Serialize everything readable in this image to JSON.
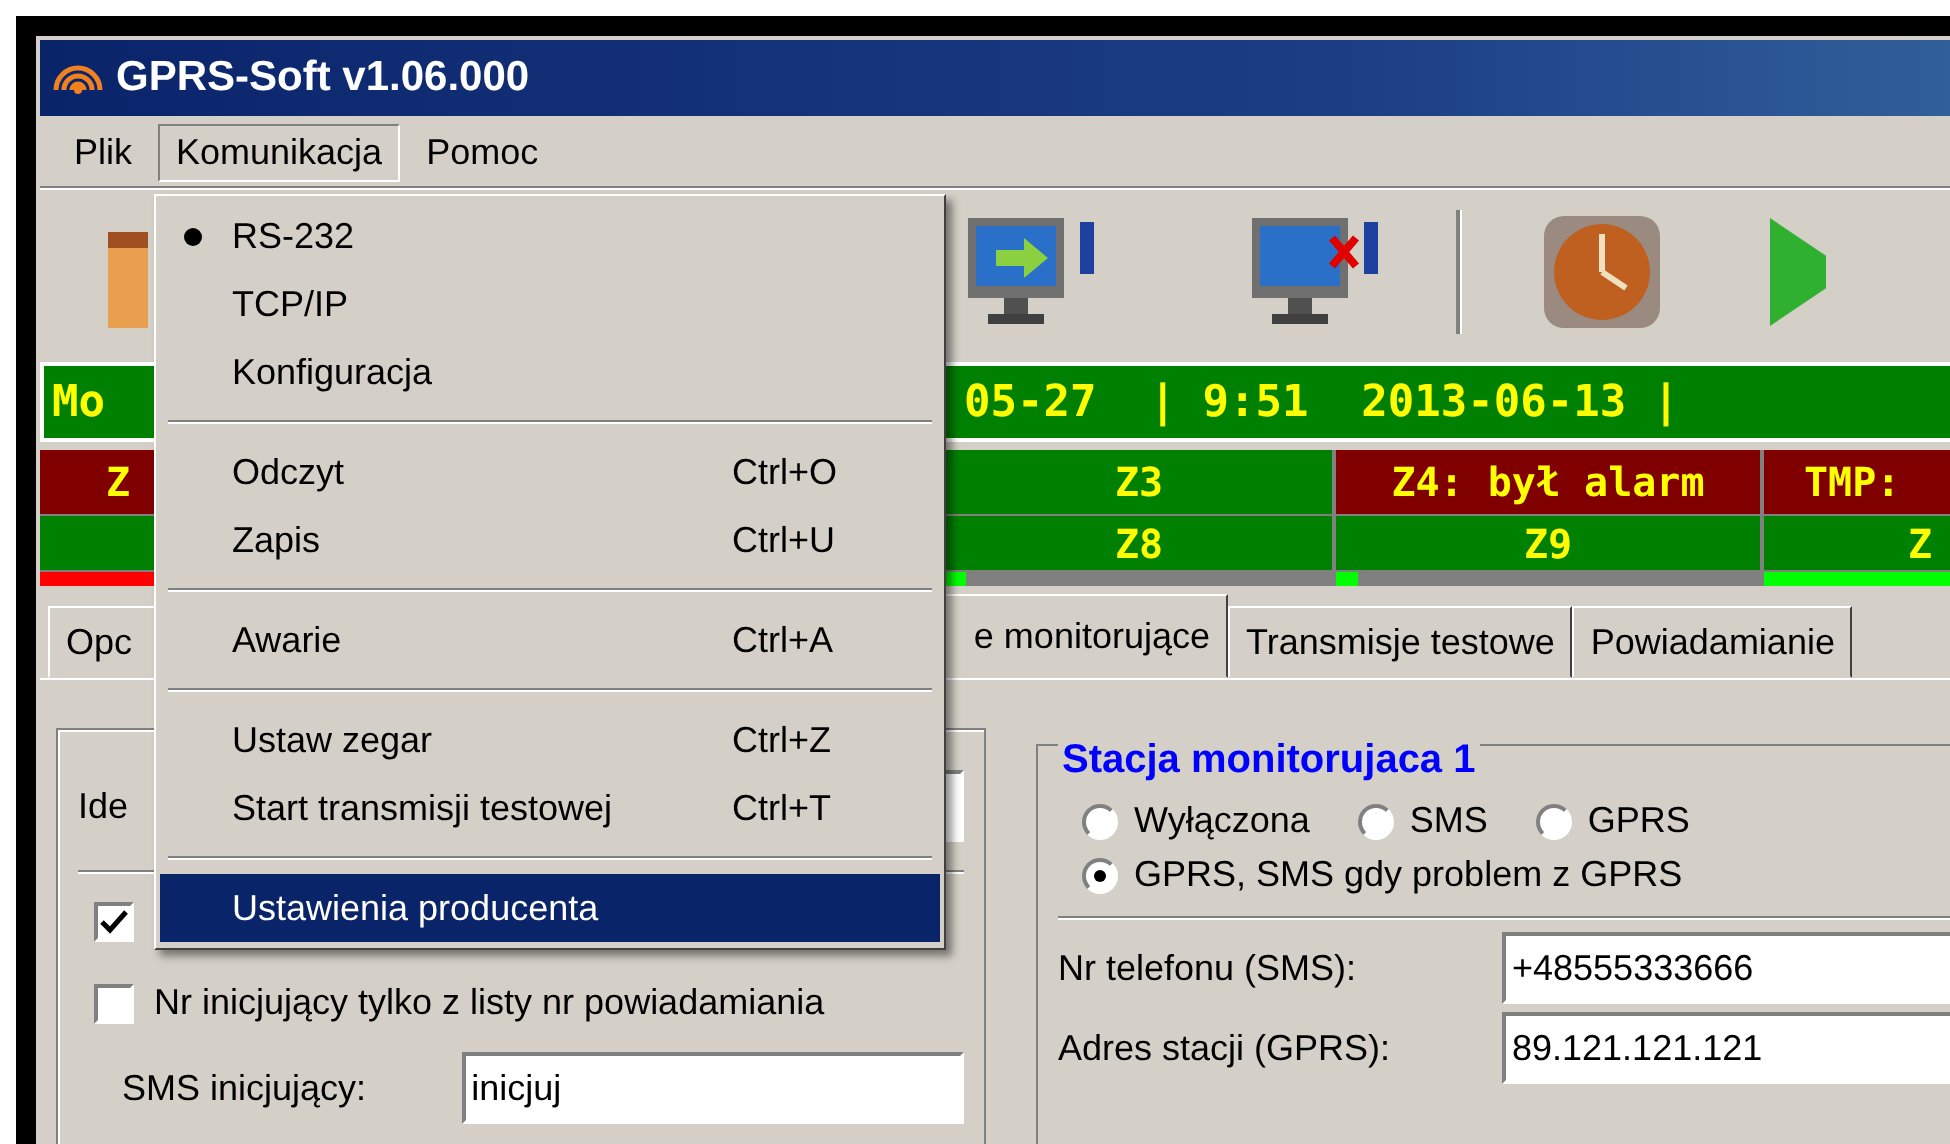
{
  "window": {
    "title": "GPRS-Soft v1.06.000"
  },
  "menu_bar": [
    {
      "label": "Plik",
      "open": false
    },
    {
      "label": "Komunikacja",
      "open": true
    },
    {
      "label": "Pomoc",
      "open": false
    }
  ],
  "status_bar": {
    "left": "Mo",
    "right": "05-27  | 9:51  2013-06-13 |"
  },
  "zones": {
    "rows": [
      {
        "cells": [
          {
            "label": "Z",
            "color": "#800000"
          },
          {
            "label": "Z3",
            "color": "#008000"
          },
          {
            "label": "Z4: był alarm",
            "color": "#800000"
          },
          {
            "label": "TMP:",
            "color": "#800000"
          }
        ]
      },
      {
        "cells": [
          {
            "color": "#008000"
          },
          {
            "label": "Z8",
            "color": "#008000"
          },
          {
            "label": "Z9",
            "color": "#008000"
          },
          {
            "label": "Z",
            "color": "#008000"
          }
        ]
      }
    ],
    "meters": [
      {
        "level": 1,
        "color": "#ff0000"
      },
      {
        "level": 0.05,
        "color": "#00ff00"
      },
      {
        "level": 0.05,
        "color": "#00ff00"
      },
      {
        "level": 1,
        "color": "#00ff00"
      }
    ]
  },
  "tabs": [
    {
      "label": "Opc",
      "selected": false
    },
    {
      "label": "e monitorujące",
      "selected": true
    },
    {
      "label": "Transmisje testowe",
      "selected": false
    },
    {
      "label": "Powiadamianie",
      "selected": false
    }
  ],
  "left_panel": {
    "id_label": "Ide",
    "checkbox_1": {
      "checked": true
    },
    "checkbox_2": {
      "label": "Nr inicjujący tylko z listy nr powiadamiania",
      "checked": false
    },
    "sms_label": "SMS inicjujący:",
    "sms_value": "inicjuj"
  },
  "station": {
    "title": "Stacja monitorujaca 1",
    "options": [
      {
        "label": "Wyłączona",
        "selected": false
      },
      {
        "label": "SMS",
        "selected": false
      },
      {
        "label": "GPRS",
        "selected": false
      },
      {
        "label": "GPRS, SMS gdy problem z GPRS",
        "selected": true
      }
    ],
    "fields": [
      {
        "label": "Nr telefonu (SMS):",
        "value": "+48555333666"
      },
      {
        "label": "Adres stacji (GPRS):",
        "value": "89.121.121.121"
      }
    ]
  },
  "dropdown": {
    "groups": [
      [
        {
          "label": "RS-232",
          "checked": true,
          "selected": false
        },
        {
          "label": "TCP/IP",
          "checked": false,
          "selected": false
        },
        {
          "label": "Konfiguracja",
          "checked": false,
          "selected": false
        }
      ],
      [
        {
          "label": "Odczyt",
          "shortcut": "Ctrl+O",
          "checked": false,
          "selected": false
        },
        {
          "label": "Zapis",
          "shortcut": "Ctrl+U",
          "checked": false,
          "selected": false
        }
      ],
      [
        {
          "label": "Awarie",
          "shortcut": "Ctrl+A",
          "checked": false,
          "selected": false
        }
      ],
      [
        {
          "label": "Ustaw zegar",
          "shortcut": "Ctrl+Z",
          "checked": false,
          "selected": false
        },
        {
          "label": "Start transmisji testowej",
          "shortcut": "Ctrl+T",
          "checked": false,
          "selected": false
        }
      ],
      [
        {
          "label": "Ustawienia producenta",
          "checked": false,
          "selected": true
        }
      ]
    ]
  }
}
